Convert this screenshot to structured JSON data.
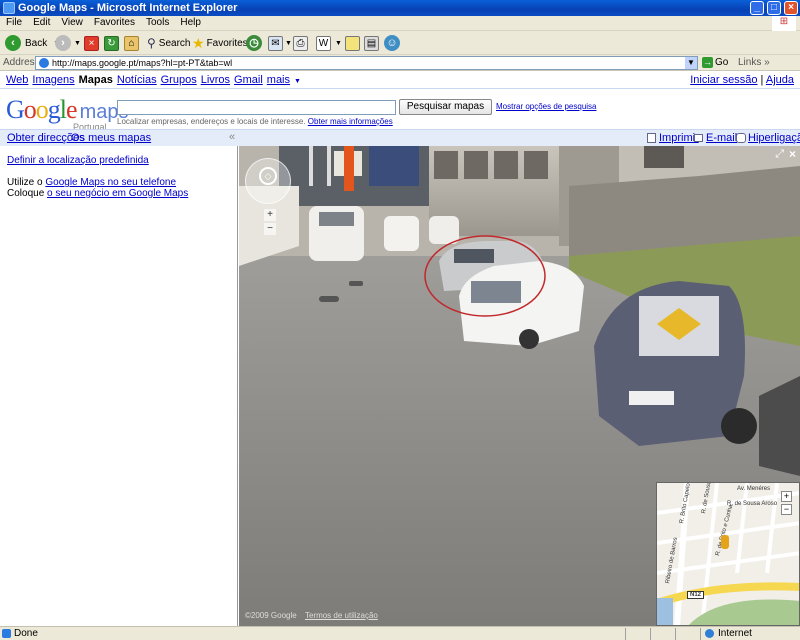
{
  "window": {
    "title": "Google Maps - Microsoft Internet Explorer",
    "minimize": "_",
    "maximize": "□",
    "close": "×"
  },
  "menu": [
    "File",
    "Edit",
    "View",
    "Favorites",
    "Tools",
    "Help"
  ],
  "toolbar": {
    "back": "Back",
    "search": "Search",
    "favorites": "Favorites"
  },
  "address": {
    "label": "Address",
    "url": "http://maps.google.pt/maps?hl=pt-PT&tab=wl",
    "go": "Go",
    "links": "Links"
  },
  "gbar": {
    "items": [
      "Web",
      "Imagens",
      "Mapas",
      "Notícias",
      "Grupos",
      "Livros",
      "Gmail",
      "mais"
    ],
    "active": "Mapas",
    "signin": "Iniciar sessão",
    "help": "Ajuda"
  },
  "logo": {
    "google": "Google",
    "maps": "maps",
    "country": "Portugal"
  },
  "search": {
    "value": "",
    "button": "Pesquisar mapas",
    "advanced": "Mostrar opções de pesquisa",
    "hint": "Localizar empresas, endereços e locais de interesse.",
    "hint_link": "Obter mais informações"
  },
  "panelbar": {
    "directions": "Obter direcções",
    "my_maps": "Os meus mapas",
    "collapse": "«",
    "print": "Imprimir",
    "email": "E-mail",
    "link": "Hiperligação"
  },
  "sidebar": {
    "default_location": "Definir a localização predefinida",
    "line1_prefix": "Utilize o",
    "line1_link": "Google Maps no seu telefone",
    "line2_prefix": "Coloque",
    "line2_link": "o seu negócio em Google Maps"
  },
  "streetview": {
    "copyright": "©2009 Google",
    "terms": "Termos de utilização",
    "expand": "⤢",
    "close": "×",
    "zoom_in": "+",
    "zoom_out": "−"
  },
  "minimap": {
    "streets": [
      "Av. Menéres",
      "R. de Sousa Aroso",
      "R. de Sousa",
      "R. Brito Capelo",
      "R. de Brito e Cunha",
      "Ribeiro de Barros",
      "N12"
    ],
    "zoom_in": "+",
    "zoom_out": "−"
  },
  "status": {
    "text": "Done",
    "zone": "Internet"
  }
}
